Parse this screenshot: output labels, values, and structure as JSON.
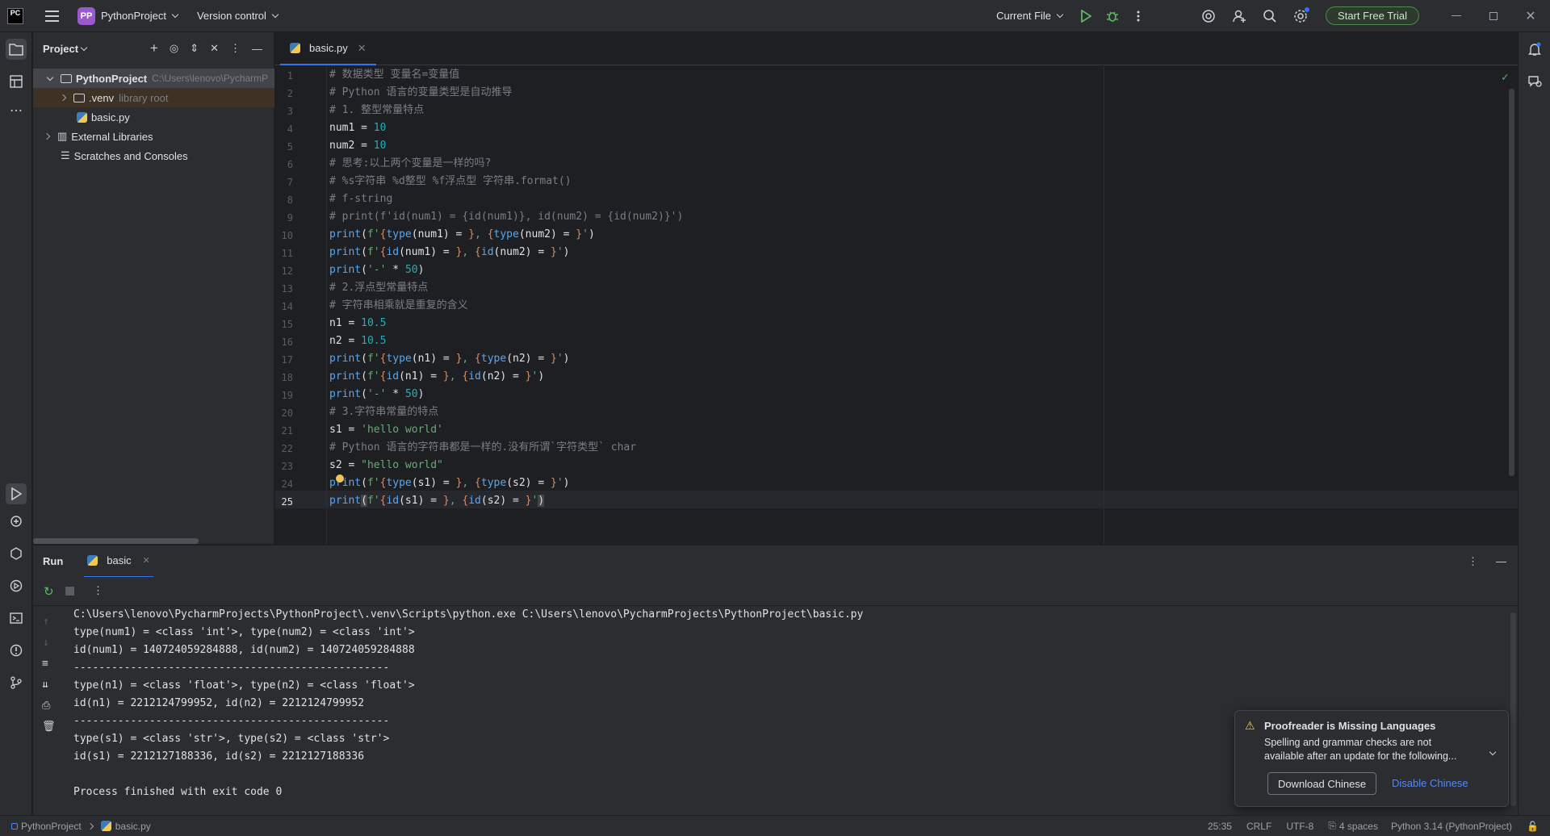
{
  "titlebar": {
    "logo_text": "PC",
    "project_badge": "PP",
    "project_name": "PythonProject",
    "vcs": "Version control",
    "run_config": "Current File",
    "trial_button": "Start Free Trial"
  },
  "project_panel": {
    "title": "Project",
    "tree": [
      {
        "label": "PythonProject",
        "hint": "C:\\Users\\lenovo\\PycharmP"
      },
      {
        "label": ".venv",
        "hint": "library root"
      },
      {
        "label": "basic.py",
        "hint": ""
      },
      {
        "label": "External Libraries",
        "hint": ""
      },
      {
        "label": "Scratches and Consoles",
        "hint": ""
      }
    ]
  },
  "editor": {
    "tab_label": "basic.py",
    "line_numbers": [
      "1",
      "2",
      "3",
      "4",
      "5",
      "6",
      "7",
      "8",
      "9",
      "10",
      "11",
      "12",
      "13",
      "14",
      "15",
      "16",
      "17",
      "18",
      "19",
      "20",
      "21",
      "22",
      "23",
      "24",
      "25"
    ],
    "code": {
      "l1": "# 数据类型 变量名=变量值",
      "l2": "# Python 语言的变量类型是自动推导",
      "l3": "# 1. 整型常量特点",
      "l4a": "num1 = ",
      "l4b": "10",
      "l5a": "num2 = ",
      "l5b": "10",
      "l6": "# 思考:以上两个变量是一样的吗?",
      "l7": "# %s字符串 %d整型 %f浮点型 字符串.format()",
      "l8": "# f-string",
      "l9": "# print(f'id(num1) = {id(num1)}, id(num2) = {id(num2)}')",
      "l10a": "print",
      "l10b": "(",
      "l10c": "f'",
      "l10d": "{",
      "l10e": "type",
      "l10f": "(num1) = ",
      "l10g": "}",
      "l10h": ", ",
      "l10i": "{",
      "l10j": "type",
      "l10k": "(num2) = ",
      "l10l": "}",
      "l10m": "'",
      "l10n": ")",
      "l11a": "print",
      "l11b": "(",
      "l11c": "f'",
      "l11d": "{",
      "l11e": "id",
      "l11f": "(num1) = ",
      "l11g": "}",
      "l11h": ", ",
      "l11i": "{",
      "l11j": "id",
      "l11k": "(num2) = ",
      "l11l": "}",
      "l11m": "'",
      "l11n": ")",
      "l12a": "print",
      "l12b": "(",
      "l12c": "'-'",
      "l12d": " * ",
      "l12e": "50",
      "l12f": ")",
      "l13": "# 2.浮点型常量特点",
      "l14": "# 字符串相乘就是重复的含义",
      "l15a": "n1 = ",
      "l15b": "10.5",
      "l16a": "n2 = ",
      "l16b": "10.5",
      "l17a": "print",
      "l17b": "(",
      "l17c": "f'",
      "l17d": "{",
      "l17e": "type",
      "l17f": "(n1) = ",
      "l17g": "}",
      "l17h": ", ",
      "l17i": "{",
      "l17j": "type",
      "l17k": "(n2) = ",
      "l17l": "}",
      "l17m": "'",
      "l17n": ")",
      "l18a": "print",
      "l18b": "(",
      "l18c": "f'",
      "l18d": "{",
      "l18e": "id",
      "l18f": "(n1) = ",
      "l18g": "}",
      "l18h": ", ",
      "l18i": "{",
      "l18j": "id",
      "l18k": "(n2) = ",
      "l18l": "}",
      "l18m": "'",
      "l18n": ")",
      "l19a": "print",
      "l19b": "(",
      "l19c": "'-'",
      "l19d": " * ",
      "l19e": "50",
      "l19f": ")",
      "l20": "# 3.字符串常量的特点",
      "l21a": "s1 = ",
      "l21b": "'hello world'",
      "l22": "# Python 语言的字符串都是一样的.没有所谓`字符类型` char",
      "l23a": "s2 = ",
      "l23b": "\"hello world\"",
      "l24a": "print",
      "l24b": "(",
      "l24c": "f'",
      "l24d": "{",
      "l24e": "type",
      "l24f": "(s1) = ",
      "l24g": "}",
      "l24h": ", ",
      "l24i": "{",
      "l24j": "type",
      "l24k": "(s2) = ",
      "l24l": "}",
      "l24m": "'",
      "l24n": ")",
      "l25a": "print",
      "l25b": "(",
      "l25c": "f'",
      "l25d": "{",
      "l25e": "id",
      "l25f": "(s1) = ",
      "l25g": "}",
      "l25h": ", ",
      "l25i": "{",
      "l25j": "id",
      "l25k": "(s2) = ",
      "l25l": "}",
      "l25m": "'",
      "l25n": ")"
    }
  },
  "run": {
    "title": "Run",
    "tab_label": "basic",
    "output": [
      "C:\\Users\\lenovo\\PycharmProjects\\PythonProject\\.venv\\Scripts\\python.exe C:\\Users\\lenovo\\PycharmProjects\\PythonProject\\basic.py",
      "type(num1) = <class 'int'>, type(num2) = <class 'int'>",
      "id(num1) = 140724059284888, id(num2) = 140724059284888",
      "--------------------------------------------------",
      "type(n1) = <class 'float'>, type(n2) = <class 'float'>",
      "id(n1) = 2212124799952, id(n2) = 2212124799952",
      "--------------------------------------------------",
      "type(s1) = <class 'str'>, type(s2) = <class 'str'>",
      "id(s1) = 2212127188336, id(s2) = 2212127188336",
      "",
      "Process finished with exit code 0"
    ]
  },
  "notification": {
    "title": "Proofreader is Missing Languages",
    "body_line1": "Spelling and grammar checks are not",
    "body_line2": "available after an update for the following...",
    "download_button": "Download Chinese",
    "disable_link": "Disable Chinese"
  },
  "statusbar": {
    "project": "PythonProject",
    "file": "basic.py",
    "position": "25:35",
    "line_ending": "CRLF",
    "encoding": "UTF-8",
    "indent": "4 spaces",
    "interpreter": "Python 3.14 (PythonProject)"
  },
  "colors": {
    "accent": "#3574f0",
    "comment": "#7a7e85",
    "function": "#56a8f5",
    "number": "#2aacb8",
    "string": "#6aab73",
    "keyword": "#cf8e6d"
  }
}
